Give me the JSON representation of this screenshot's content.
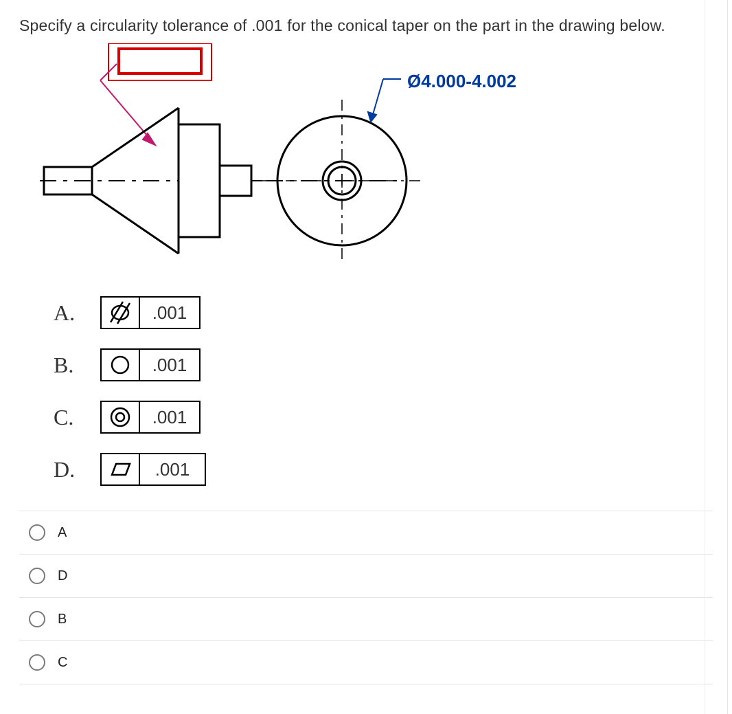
{
  "question": "Specify a circularity tolerance of .001 for the conical taper on the part in the drawing below.",
  "dimension": "Ø4.000-4.002",
  "options": {
    "A": {
      "letter": "A.",
      "symbol": "cylindricity",
      "value": ".001"
    },
    "B": {
      "letter": "B.",
      "symbol": "circularity",
      "value": ".001"
    },
    "C": {
      "letter": "C.",
      "symbol": "concentricity",
      "value": ".001"
    },
    "D": {
      "letter": "D.",
      "symbol": "flatness",
      "value": ".001"
    }
  },
  "answers": [
    {
      "label": "A"
    },
    {
      "label": "D"
    },
    {
      "label": "B"
    },
    {
      "label": "C"
    }
  ]
}
